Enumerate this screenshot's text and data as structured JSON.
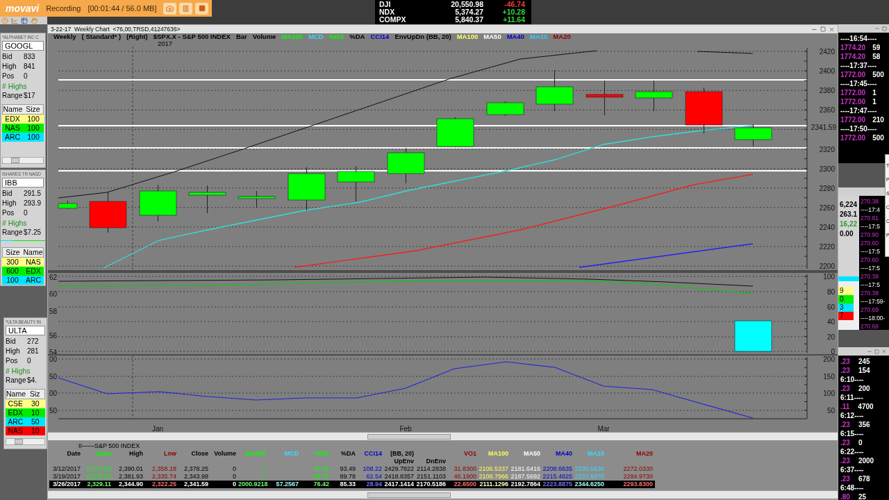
{
  "recorder": {
    "logo": "movavi",
    "status": "Recording",
    "timer": "[00:01:44 / 56.0 MB]"
  },
  "ticker": [
    {
      "symbol": "DJI",
      "price": "20,550.98",
      "change": "-46.74",
      "color": "#ff3b3b"
    },
    {
      "symbol": "NDX",
      "price": "5,374.27",
      "change": "+10.28",
      "color": "#33dd33"
    },
    {
      "symbol": "COMPX",
      "price": "5,840.37",
      "change": "+11.64",
      "color": "#33dd33"
    }
  ],
  "quote_panels": [
    {
      "title": "*ALPHABET INC C",
      "symbol": "GOOGL",
      "fields": [
        {
          "label": "Bid",
          "value": "833"
        },
        {
          "label": "High",
          "value": "841"
        },
        {
          "label": "Pos",
          "value": "0"
        }
      ],
      "highs": "# Highs",
      "range": {
        "label": "Range",
        "value": "$17"
      },
      "book_columns": [
        "Name",
        "Size"
      ],
      "book": [
        {
          "cells": [
            "EDX",
            "100"
          ],
          "color": "#ffff88"
        },
        {
          "cells": [
            "NAS",
            "100"
          ],
          "color": "#00ee00"
        },
        {
          "cells": [
            "ARC",
            "100"
          ],
          "color": "#00e5ff"
        }
      ],
      "scrollbar": true
    },
    {
      "title": "ISHARES TR NASD",
      "symbol": "IBB",
      "fields": [
        {
          "label": "Bid",
          "value": "291.5"
        },
        {
          "label": "High",
          "value": "293.9"
        },
        {
          "label": "Pos",
          "value": "0"
        }
      ],
      "highs": "# Highs",
      "range": {
        "label": "Range",
        "value": "$7.25"
      },
      "meter": {
        "level": 0.27
      },
      "book_columns": [
        "Size",
        "Name"
      ],
      "book": [
        {
          "cells": [
            "300",
            "NAS"
          ],
          "color": "#ffff88"
        },
        {
          "cells": [
            "600",
            "EDX"
          ],
          "color": "#00ee00"
        },
        {
          "cells": [
            "100",
            "ARC"
          ],
          "color": "#00e5ff"
        }
      ],
      "scrollbar": false
    },
    {
      "title": "*ULTA BEAUTY IN",
      "symbol": "ULTA",
      "fields": [
        {
          "label": "Bid",
          "value": "272"
        },
        {
          "label": "High",
          "value": "281"
        },
        {
          "label": "Pos",
          "value": "0"
        }
      ],
      "highs": "# Highs",
      "range": {
        "label": "Range",
        "value": "$4."
      },
      "book_columns": [
        "Name",
        "Siz"
      ],
      "book": [
        {
          "cells": [
            "CSE",
            "30"
          ],
          "color": "#ffff88"
        },
        {
          "cells": [
            "EDX",
            "10"
          ],
          "color": "#00ee00"
        },
        {
          "cells": [
            "ARC",
            "50"
          ],
          "color": "#00e5ff"
        },
        {
          "cells": [
            "NAS",
            "10"
          ],
          "color": "#ff0000"
        }
      ],
      "scrollbar": true
    }
  ],
  "chart_window": {
    "title": "3-22-17  Weekly Chart  <76,00,TRSD,41247636>",
    "legend": [
      {
        "text": "Weekly",
        "color": "#000000"
      },
      {
        "text": "( Standard* )",
        "color": "#000000"
      },
      {
        "text": "(Right)",
        "color": "#000000"
      },
      {
        "text": "$SPX.X - S&P 500 INDEX",
        "color": "#000000"
      },
      {
        "text": "Bar",
        "color": "#000000"
      },
      {
        "text": "Volume",
        "color": "#000000"
      },
      {
        "text": "MA200",
        "color": "#00ff00"
      },
      {
        "text": "MCD",
        "color": "#33ddee"
      },
      {
        "text": "%DS",
        "color": "#00ff00"
      },
      {
        "text": "%DA",
        "color": "#000000"
      },
      {
        "text": "CCI14",
        "color": "#0000cc"
      },
      {
        "text": "EnvUpDn (BB, 20)",
        "color": "#000000"
      },
      {
        "text": "MA100",
        "color": "#ffff66"
      },
      {
        "text": "MA50",
        "color": "#ffffff"
      },
      {
        "text": "MA40",
        "color": "#0000cc"
      },
      {
        "text": "MA10",
        "color": "#33ccff"
      },
      {
        "text": "MA20",
        "color": "#900000"
      }
    ],
    "year": "2017",
    "price_axis": [
      "2420",
      "2400",
      "2380",
      "2360",
      "2320",
      "2300",
      "2280",
      "2260",
      "2240",
      "2220",
      "2200"
    ],
    "last_price": "2341.59",
    "indicator_left_axis": [
      "62",
      "60",
      "58",
      "56",
      "54"
    ],
    "indicator_right_axis": [
      "100",
      "80",
      "60",
      "40",
      "20",
      "0"
    ],
    "cci_left_axis": [
      "00",
      "50",
      "00",
      "50"
    ],
    "cci_right_axis": [
      "200",
      "150",
      "100",
      "50"
    ],
    "months": [
      "Jan",
      "Feb",
      "Mar"
    ]
  },
  "data_table": {
    "title": "II——S&P 500 INDEX",
    "columns": [
      {
        "header": "Date",
        "color": "#000000"
      },
      {
        "header": "Open",
        "color": "#00ff00"
      },
      {
        "header": "High",
        "color": "#000000"
      },
      {
        "header": "Low",
        "color": "#900000"
      },
      {
        "header": "Close",
        "color": "#000000"
      },
      {
        "header": "Volume",
        "color": "#000000"
      },
      {
        "header": "MA200",
        "color": "#00ff00"
      },
      {
        "header": "MCD",
        "color": "#33ddff"
      },
      {
        "header": "%DS",
        "color": "#00ff00"
      },
      {
        "header": "%DA",
        "color": "#000000"
      },
      {
        "header": "CCI14",
        "color": "#0000cc"
      },
      {
        "header": "(BB, 20)",
        "sub": "UpEnv",
        "color": "#000000"
      },
      {
        "sub": "DnEnv",
        "color": "#000000"
      },
      {
        "header": "VO1",
        "color": "#900000"
      },
      {
        "header": "MA100",
        "color": "#ffff55"
      },
      {
        "header": "MA50",
        "color": "#ffffff"
      },
      {
        "header": "MA40",
        "color": "#0000cc"
      },
      {
        "header": "MA10",
        "color": "#33ddff"
      },
      {
        "header": "MA20",
        "color": "#900000"
      }
    ],
    "rows": [
      {
        "selected": false,
        "cells": [
          "3/12/2017",
          "2,371.56",
          "2,390.01",
          "2,358.18",
          "2,378.25",
          "0",
          "?",
          null,
          "90.59",
          "93.49",
          "108.22",
          "2429.7822",
          "2114.2838",
          "31.8300",
          "2106.5337",
          "2181.6416",
          "2208.6635",
          "2330.6630",
          "2272.0330"
        ]
      },
      {
        "selected": false,
        "cells": [
          "3/19/2017",
          "2,378.24",
          "2,381.93",
          "2,335.74",
          "2,343.98",
          "0",
          "?",
          null,
          "82.37",
          "89.78",
          "62.54",
          "2418.8357",
          "2151.1103",
          "46.1900",
          "2108.7966",
          "2187.5692",
          "2215.4825",
          "2337.5970",
          "2284.9730"
        ]
      },
      {
        "selected": true,
        "cells": [
          "3/26/2017",
          "2,329.11",
          "2,344.90",
          "2,322.25",
          "2,341.59",
          "0",
          "2000.9218",
          "57.2567",
          "76.42",
          "85.33",
          "28.94",
          "2417.1414",
          "2170.5186",
          "22.6500",
          "2111.1296",
          "2192.7864",
          "2223.8875",
          "2344.6250",
          "2293.8300"
        ]
      }
    ]
  },
  "time_sales_top": [
    {
      "kind": "time",
      "text": "----16:54----"
    },
    {
      "kind": "trade",
      "price": "1774.20",
      "size": "59"
    },
    {
      "kind": "trade",
      "price": "1774.20",
      "size": "58"
    },
    {
      "kind": "time",
      "text": "----17:37----"
    },
    {
      "kind": "trade",
      "price": "1772.00",
      "size": "500"
    },
    {
      "kind": "time",
      "text": "----17:45----"
    },
    {
      "kind": "trade",
      "price": "1772.00",
      "size": "1"
    },
    {
      "kind": "trade",
      "price": "1772.00",
      "size": "1"
    },
    {
      "kind": "time",
      "text": "----17:47----"
    },
    {
      "kind": "trade",
      "price": "1772.00",
      "size": "210"
    },
    {
      "kind": "time",
      "text": "----17:50----"
    },
    {
      "kind": "trade",
      "price": "1772.00",
      "size": "500"
    }
  ],
  "popup_letters": [
    "T",
    "P",
    "S",
    "C",
    "C",
    "P"
  ],
  "middle_panel": {
    "values": [
      {
        "text": "6,224",
        "color": "#000000"
      },
      {
        "text": "263.1",
        "color": "#000000"
      },
      {
        "text": "16,22",
        "color": "#2e9b2e"
      },
      {
        "text": "0.00",
        "color": "#000000"
      }
    ],
    "mini_book": [
      {
        "text": "9",
        "color": "#ffff88"
      },
      {
        "text": "0",
        "color": "#00ee00"
      },
      {
        "text": "3",
        "color": "#00e5ff"
      },
      {
        "text": "7",
        "color": "#ff0000"
      }
    ],
    "trades": [
      {
        "kind": "trade",
        "price": "270.38"
      },
      {
        "kind": "time",
        "text": "----17:4"
      },
      {
        "kind": "trade",
        "price": "270.81"
      },
      {
        "kind": "time",
        "text": "----17:5"
      },
      {
        "kind": "trade",
        "price": "270.90"
      },
      {
        "kind": "trade",
        "price": "270.60"
      },
      {
        "kind": "time",
        "text": "----17:5"
      },
      {
        "kind": "trade",
        "price": "270.60"
      },
      {
        "kind": "time",
        "text": "----17:5"
      },
      {
        "kind": "trade",
        "price": "270.38"
      },
      {
        "kind": "time",
        "text": "----17:5"
      },
      {
        "kind": "trade",
        "price": "270.38"
      },
      {
        "kind": "time",
        "text": "----17:59-"
      },
      {
        "kind": "trade",
        "price": "270.69"
      },
      {
        "kind": "time",
        "text": "----18:00-"
      },
      {
        "kind": "trade",
        "price": "270.69"
      }
    ]
  },
  "time_sales_bottom": [
    {
      "kind": "trade",
      "price": ".23",
      "size": "245"
    },
    {
      "kind": "trade",
      "price": ".23",
      "size": "154"
    },
    {
      "kind": "time",
      "text": "6:10----"
    },
    {
      "kind": "trade",
      "price": ".23",
      "size": "200"
    },
    {
      "kind": "time",
      "text": "6:11----"
    },
    {
      "kind": "trade",
      "price": ".11",
      "size": "4700"
    },
    {
      "kind": "time",
      "text": "6:12----"
    },
    {
      "kind": "trade",
      "price": ".23",
      "size": "356"
    },
    {
      "kind": "time",
      "text": "6:15----"
    },
    {
      "kind": "trade",
      "price": ".23",
      "size": "0"
    },
    {
      "kind": "time",
      "text": "6:22----"
    },
    {
      "kind": "trade",
      "price": ".23",
      "size": "2000"
    },
    {
      "kind": "time",
      "text": "6:37----"
    },
    {
      "kind": "trade",
      "price": ".23",
      "size": "678"
    },
    {
      "kind": "time",
      "text": "6:48----"
    },
    {
      "kind": "trade",
      "price": ".80",
      "size": "25"
    }
  ]
}
